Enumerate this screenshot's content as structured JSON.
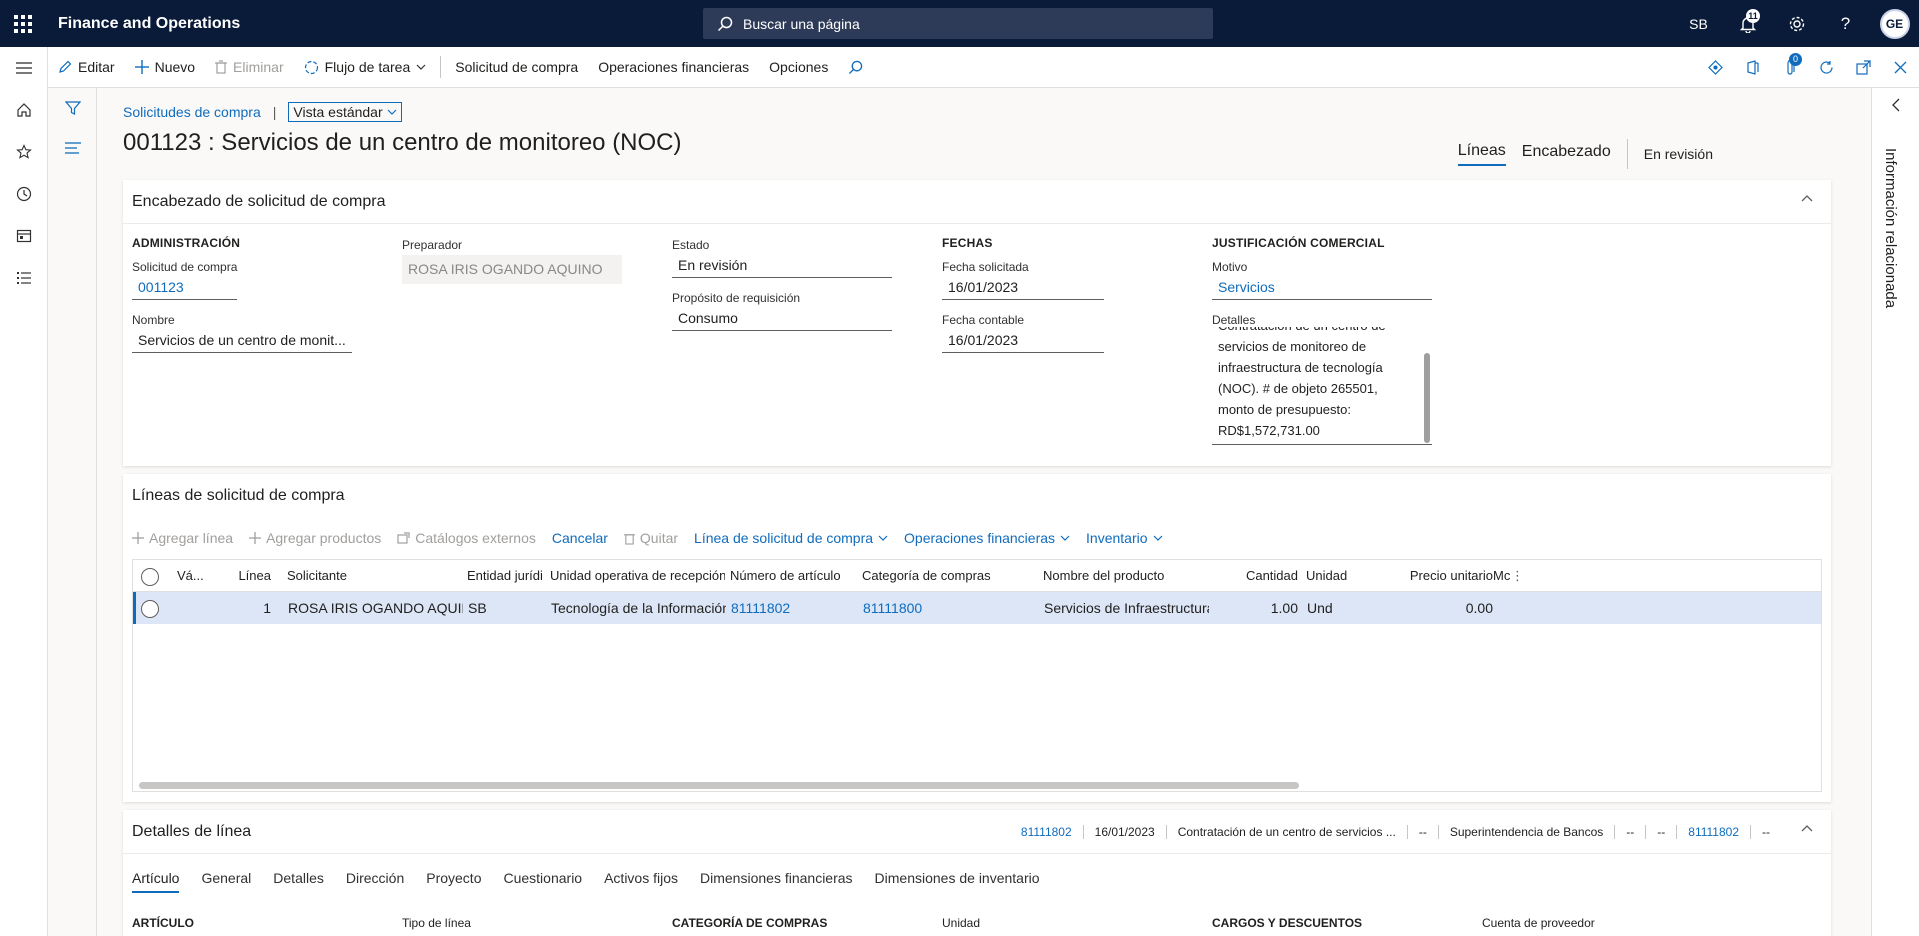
{
  "topbar": {
    "app_title": "Finance and Operations",
    "search_placeholder": "Buscar una página",
    "company": "SB",
    "notifications_count": "11",
    "avatar_initials": "GE"
  },
  "actionbar": {
    "edit": "Editar",
    "new": "Nuevo",
    "delete": "Eliminar",
    "workflow": "Flujo de tarea",
    "purchase_requisition": "Solicitud de compra",
    "financial_ops": "Operaciones financieras",
    "options": "Opciones",
    "attach_count": "0"
  },
  "breadcrumb": {
    "link": "Solicitudes de compra",
    "separator": "|",
    "view": "Vista estándar"
  },
  "page_title": "001123 : Servicios de un centro de monitoreo (NOC)",
  "view_tabs": {
    "lines": "Líneas",
    "header": "Encabezado",
    "status": "En revisión"
  },
  "header_panel": {
    "title": "Encabezado de solicitud de compra",
    "admin_title": "ADMINISTRACIÓN",
    "req_label": "Solicitud de compra",
    "req_value": "001123",
    "name_label": "Nombre",
    "name_value": "Servicios de un centro de monit...",
    "preparer_label": "Preparador",
    "preparer_value": "ROSA IRIS OGANDO AQUINO",
    "status_label": "Estado",
    "status_value": "En revisión",
    "purpose_label": "Propósito de requisición",
    "purpose_value": "Consumo",
    "dates_title": "FECHAS",
    "requested_date_label": "Fecha solicitada",
    "requested_date_value": "16/01/2023",
    "accounting_date_label": "Fecha contable",
    "accounting_date_value": "16/01/2023",
    "justification_title": "JUSTIFICACIÓN COMERCIAL",
    "reason_label": "Motivo",
    "reason_value": "Servicios",
    "details_label": "Detalles",
    "details_lines": [
      "Contratación de un centro de",
      "servicios de monitoreo de",
      "infraestructura de tecnología",
      "(NOC). # de objeto 265501,",
      "monto de presupuesto:",
      "RD$1,572,731.00"
    ]
  },
  "lines_panel": {
    "title": "Líneas de solicitud de compra",
    "toolbar": {
      "add_line": "Agregar línea",
      "add_products": "Agregar productos",
      "external_catalogs": "Catálogos externos",
      "cancel": "Cancelar",
      "remove": "Quitar",
      "line_menu": "Línea de solicitud de compra",
      "financial_ops": "Operaciones financieras",
      "inventory": "Inventario"
    },
    "columns": {
      "valid": "Vá...",
      "line": "Línea",
      "requester": "Solicitante",
      "legal_entity": "Entidad jurídic...",
      "receiving_unit": "Unidad operativa de recepción",
      "item_number": "Número de artículo",
      "procurement_category": "Categoría de compras",
      "product_name": "Nombre del producto",
      "quantity": "Cantidad",
      "unit": "Unidad",
      "unit_price": "Precio unitario",
      "more": "Mc"
    },
    "rows": [
      {
        "line": "1",
        "requester": "ROSA IRIS OGANDO AQUINO",
        "legal_entity": "SB",
        "receiving_unit": "Tecnología de la Información",
        "item_number": "81111802",
        "procurement_category": "81111800",
        "product_name": "Servicios de Infraestructura de TI",
        "quantity": "1.00",
        "unit": "Und",
        "unit_price": "0.00"
      }
    ]
  },
  "line_details": {
    "title": "Detalles de línea",
    "summary": [
      "81111802",
      "16/01/2023",
      "Contratación de un centro de servicios ...",
      "--",
      "Superintendencia de Bancos",
      "--",
      "--",
      "81111802",
      "--"
    ],
    "tabs": [
      "Artículo",
      "General",
      "Detalles",
      "Dirección",
      "Proyecto",
      "Cuestionario",
      "Activos fijos",
      "Dimensiones financieras",
      "Dimensiones de inventario"
    ],
    "bottom": {
      "article": "ARTÍCULO",
      "line_type": "Tipo de línea",
      "procurement_category": "CATEGORÍA DE COMPRAS",
      "unit": "Unidad",
      "charges": "CARGOS Y DESCUENTOS",
      "vendor_account": "Cuenta de proveedor"
    }
  },
  "related_info": "Información relacionada"
}
